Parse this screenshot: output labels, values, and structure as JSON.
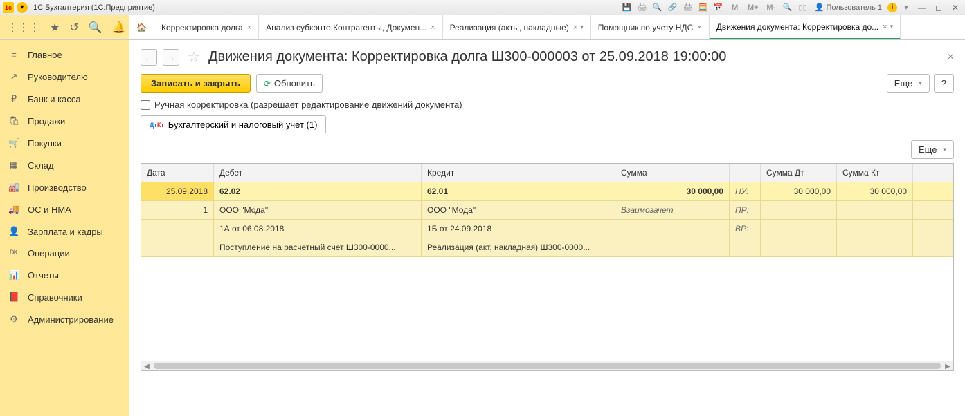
{
  "titlebar": {
    "app": "1С:Бухгалтерия  (1С:Предприятие)",
    "user": "Пользователь 1"
  },
  "tabs": [
    {
      "label": "Корректировка долга"
    },
    {
      "label": "Анализ субконто Контрагенты, Докумен..."
    },
    {
      "label": "Реализация (акты, накладные)"
    },
    {
      "label": "Помощник по учету НДС"
    },
    {
      "label": "Движения документа: Корректировка до...",
      "active": true
    }
  ],
  "sidebar": [
    {
      "icon": "≡",
      "label": "Главное"
    },
    {
      "icon": "↗",
      "label": "Руководителю"
    },
    {
      "icon": "₽",
      "label": "Банк и касса"
    },
    {
      "icon": "🛍",
      "label": "Продажи"
    },
    {
      "icon": "🛒",
      "label": "Покупки"
    },
    {
      "icon": "▦",
      "label": "Склад"
    },
    {
      "icon": "🏭",
      "label": "Производство"
    },
    {
      "icon": "🚚",
      "label": "ОС и НМА"
    },
    {
      "icon": "👤",
      "label": "Зарплата и кадры"
    },
    {
      "icon": "ᴰᴷ",
      "label": "Операции"
    },
    {
      "icon": "📊",
      "label": "Отчеты"
    },
    {
      "icon": "📕",
      "label": "Справочники"
    },
    {
      "icon": "⚙",
      "label": "Администрирование"
    }
  ],
  "page": {
    "title": "Движения документа: Корректировка долга Ш300-000003 от 25.09.2018 19:00:00",
    "save_close": "Записать и закрыть",
    "refresh": "Обновить",
    "more": "Еще",
    "help": "?",
    "checkbox_label": "Ручная корректировка (разрешает редактирование движений документа)",
    "doc_tab": "Бухгалтерский и налоговый учет (1)"
  },
  "grid": {
    "headers": {
      "date": "Дата",
      "debit": "Дебет",
      "credit": "Кредит",
      "sum": "Сумма",
      "sumdt": "Сумма Дт",
      "sumkt": "Сумма Кт"
    },
    "rows": [
      {
        "date": "25.09.2018",
        "line": "1",
        "deb_acc": "62.02",
        "cred_acc": "62.01",
        "sum": "30 000,00",
        "tag": "НУ:",
        "sumdt": "30 000,00",
        "sumkt": "30 000,00",
        "deb_party": "ООО \"Мода\"",
        "cred_party": "ООО \"Мода\"",
        "note": "Взаимозачет",
        "tag2": "ПР:",
        "deb_doc": "1А от 06.08.2018",
        "cred_doc": "1Б от 24.09.2018",
        "tag3": "ВР:",
        "deb_src": "Поступление на расчетный счет Ш300-0000...",
        "cred_src": "Реализация (акт, накладная) Ш300-0000..."
      }
    ]
  }
}
